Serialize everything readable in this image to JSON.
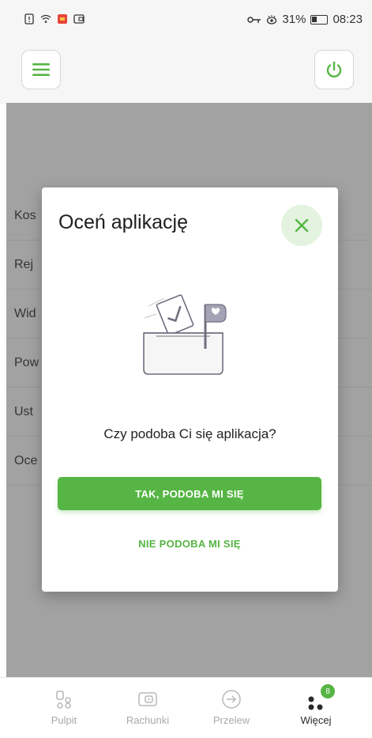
{
  "status_bar": {
    "battery_percent": "31%",
    "time": "08:23"
  },
  "page_list": {
    "items": [
      "Kos",
      "Rej",
      "Wid",
      "Pow",
      "Ust",
      "Oce"
    ]
  },
  "modal": {
    "title": "Oceń aplikację",
    "question": "Czy podoba Ci się aplikacja?",
    "yes_label": "TAK, PODOBA MI SIĘ",
    "no_label": "NIE PODOBA MI SIĘ"
  },
  "bottom_nav": {
    "items": [
      {
        "label": "Pulpit",
        "icon": "dashboard-icon"
      },
      {
        "label": "Rachunki",
        "icon": "wallet-icon"
      },
      {
        "label": "Przelew",
        "icon": "transfer-arrow-icon"
      },
      {
        "label": "Więcej",
        "icon": "more-dots-icon",
        "badge": "8"
      }
    ]
  },
  "colors": {
    "accent": "#56b544",
    "close_bg": "#e3f3df",
    "overlay": "rgba(70,70,70,0.5)"
  }
}
